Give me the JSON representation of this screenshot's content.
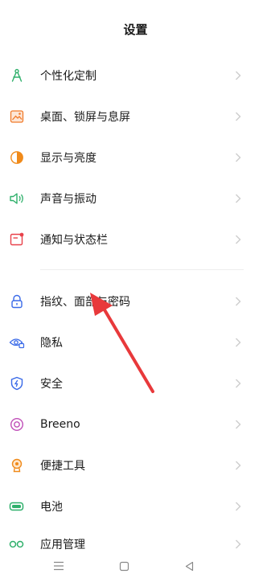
{
  "header": {
    "title": "设置"
  },
  "accent": "#2fb06b",
  "groups": [
    {
      "items": [
        {
          "label": "个性化定制",
          "icon": "compass-icon",
          "color": "#2fb06b"
        },
        {
          "label": "桌面、锁屏与息屏",
          "icon": "wallpaper-icon",
          "color": "#f07a2a"
        },
        {
          "label": "显示与亮度",
          "icon": "brightness-icon",
          "color": "#f08a1a"
        },
        {
          "label": "声音与振动",
          "icon": "sound-icon",
          "color": "#2fb06b"
        },
        {
          "label": "通知与状态栏",
          "icon": "notification-icon",
          "color": "#e8414a"
        }
      ]
    },
    {
      "items": [
        {
          "label": "指纹、面部与密码",
          "icon": "lock-icon",
          "color": "#3a6ae8"
        },
        {
          "label": "隐私",
          "icon": "privacy-eye-icon",
          "color": "#3a6ae8"
        },
        {
          "label": "安全",
          "icon": "shield-icon",
          "color": "#3a6ae8"
        },
        {
          "label": "Breeno",
          "icon": "breeno-icon",
          "color": "#c04fb8"
        },
        {
          "label": "便捷工具",
          "icon": "tools-icon",
          "color": "#f08a1a"
        },
        {
          "label": "电池",
          "icon": "battery-icon",
          "color": "#2fb06b"
        },
        {
          "label": "应用管理",
          "icon": "apps-icon",
          "color": "#2fb06b"
        }
      ]
    }
  ],
  "annotation": {
    "color": "#e8393b",
    "points_to": "指纹、面部与密码"
  },
  "navbar": {
    "buttons": [
      "menu-icon",
      "home-icon",
      "back-icon"
    ]
  }
}
